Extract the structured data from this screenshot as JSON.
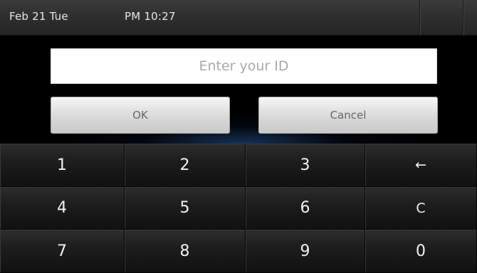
{
  "status_bar": {
    "date": "Feb 21 Tue",
    "time": "PM 10:27"
  },
  "login": {
    "id_placeholder": "Enter your ID",
    "ok_label": "OK",
    "cancel_label": "Cancel"
  },
  "keypad": {
    "keys": [
      "1",
      "2",
      "3",
      "←",
      "4",
      "5",
      "6",
      "C",
      "7",
      "8",
      "9",
      "0"
    ]
  }
}
